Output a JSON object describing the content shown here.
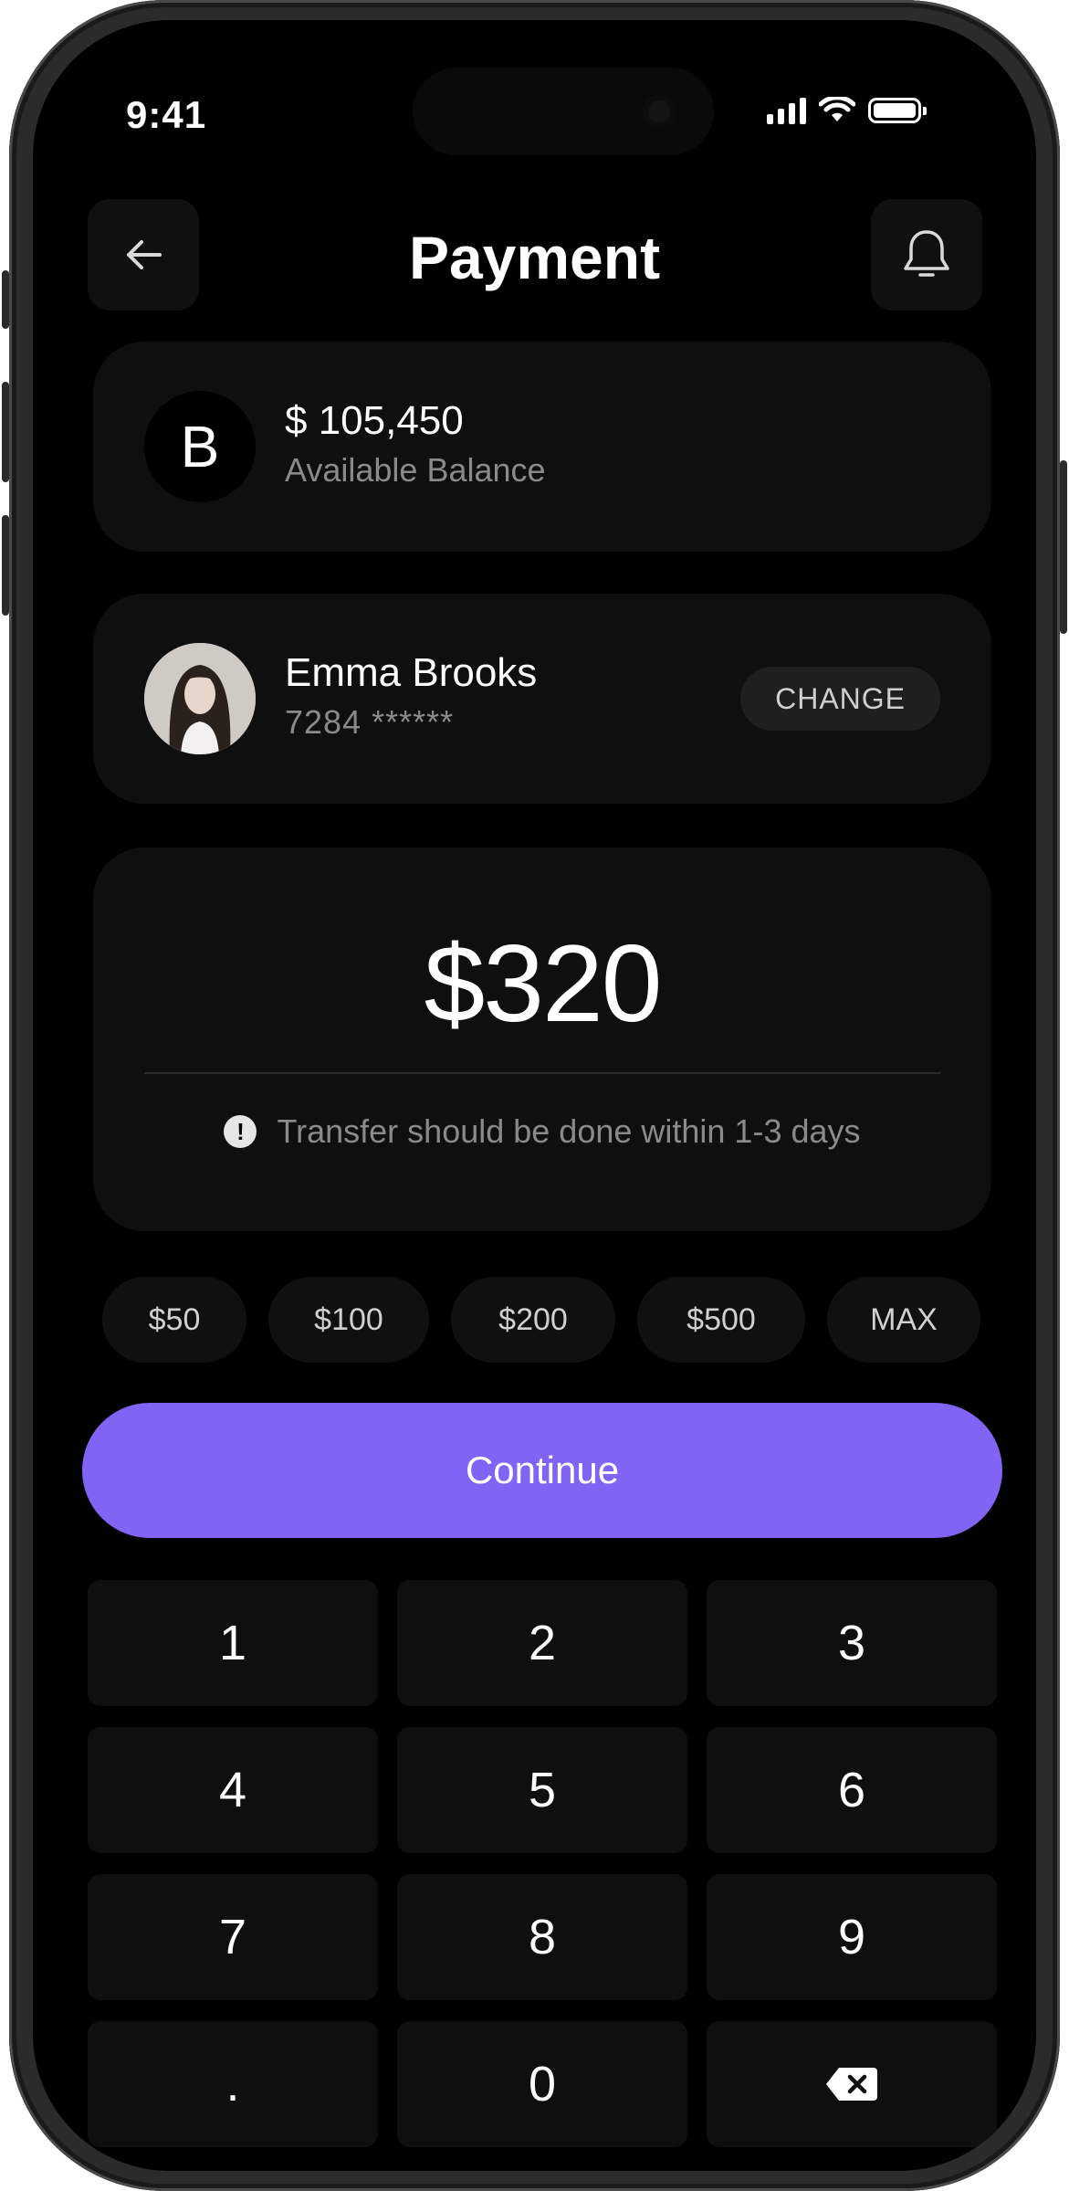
{
  "status_bar": {
    "time": "9:41"
  },
  "header": {
    "title": "Payment",
    "back_icon": "arrow-left-icon",
    "notification_icon": "bell-icon"
  },
  "balance": {
    "avatar_letter": "B",
    "amount": "$ 105,450",
    "label": "Available Balance"
  },
  "payee": {
    "name": "Emma Brooks",
    "account": "7284 ******",
    "change_label": "CHANGE"
  },
  "transfer": {
    "amount": "$320",
    "hint": "Transfer should be done within 1-3 days",
    "hint_icon": "info-icon"
  },
  "quick_amounts": [
    "$50",
    "$100",
    "$200",
    "$500",
    "MAX"
  ],
  "continue_label": "Continue",
  "keypad": [
    "1",
    "2",
    "3",
    "4",
    "5",
    "6",
    "7",
    "8",
    "9",
    ".",
    "0"
  ],
  "colors": {
    "accent": "#8264f5",
    "background": "#000000",
    "card": "#0f0f0f"
  }
}
